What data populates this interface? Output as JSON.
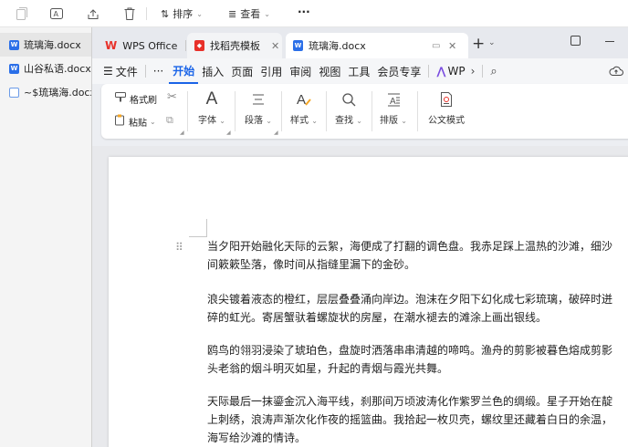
{
  "explorer": {
    "toolbar": {
      "sort_label": "排序",
      "view_label": "查看",
      "more_label": "···"
    },
    "files": [
      {
        "name": "琉璃海.docx"
      },
      {
        "name": "山谷私语.docx"
      },
      {
        "name": "~$琉璃海.docx"
      }
    ]
  },
  "wps": {
    "tabs": [
      {
        "label": "WPS Office"
      },
      {
        "label": "找稻壳模板"
      },
      {
        "label": "琉璃海.docx"
      }
    ],
    "menu": {
      "file_label": "文件",
      "more_label": "···",
      "items": [
        "开始",
        "插入",
        "页面",
        "引用",
        "审阅",
        "视图",
        "工具",
        "会员专享"
      ],
      "ai_label": "WP"
    },
    "ribbon": {
      "format_painter": "格式刷",
      "paste": "粘贴",
      "font": "字体",
      "paragraph": "段落",
      "style": "样式",
      "find": "查找",
      "layout": "排版",
      "official_mode": "公文模式"
    },
    "document": {
      "paragraphs": [
        [
          "当夕阳开始融化天际的云絮，海便成了打翻的调色盘。我赤足踩上温热的沙滩，细沙",
          "间簌簌坠落，像时间从指缝里漏下的金砂。"
        ],
        [
          "浪尖镀着液态的橙红，层层叠叠涌向岸边。泡沫在夕阳下幻化成七彩琉璃，破碎时迸",
          "碎的虹光。寄居蟹驮着螺旋状的房屋，在潮水褪去的滩涂上画出银线。"
        ],
        [
          "鸥鸟的翎羽浸染了琥珀色，盘旋时洒落串串清越的啼鸣。渔舟的剪影被暮色熔成剪影",
          "头老翁的烟斗明灭如星，升起的青烟与霞光共舞。"
        ],
        [
          "天际最后一抹鎏金沉入海平线，刹那间万顷波涛化作紫罗兰色的绸缎。星子开始在靛",
          "上刺绣，浪涛声渐次化作夜的摇篮曲。我拾起一枚贝壳，螺纹里还藏着白日的余温，",
          "海写给沙滩的情诗。"
        ]
      ]
    }
  }
}
